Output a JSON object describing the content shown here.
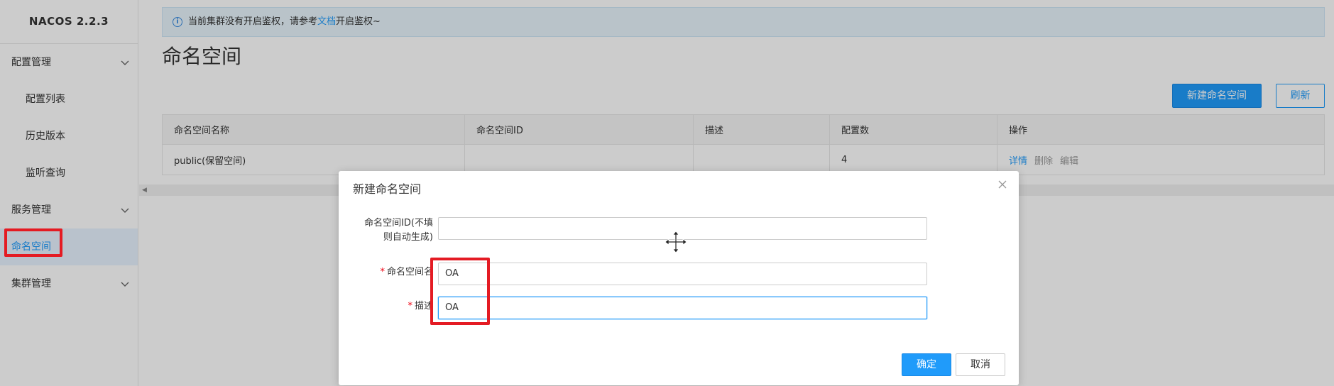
{
  "app": {
    "brand": "NACOS 2.2.3"
  },
  "sidebar": {
    "groups": [
      {
        "label": "配置管理",
        "items": [
          "配置列表",
          "历史版本",
          "监听查询"
        ]
      },
      {
        "label": "服务管理",
        "items": []
      },
      {
        "active_item": "命名空间"
      },
      {
        "label": "集群管理",
        "items": []
      }
    ]
  },
  "notice": {
    "prefix": "当前集群没有开启鉴权，请参考",
    "link": "文档",
    "suffix": "开启鉴权~"
  },
  "page": {
    "title": "命名空间"
  },
  "toolbar": {
    "create_label": "新建命名空间",
    "refresh_label": "刷新"
  },
  "table": {
    "columns": [
      "命名空间名称",
      "命名空间ID",
      "描述",
      "配置数",
      "操作"
    ],
    "rows": [
      {
        "name": "public(保留空间)",
        "id": "",
        "desc": "",
        "count": "4",
        "ops": [
          "详情",
          "删除",
          "编辑"
        ]
      }
    ]
  },
  "dialog": {
    "title": "新建命名空间",
    "fields": [
      {
        "label_line1": "命名空间ID(不填",
        "label_line2": "则自动生成)",
        "value": "",
        "required": false
      },
      {
        "label": "命名空间名",
        "value": "OA",
        "required": true
      },
      {
        "label": "描述",
        "value": "OA",
        "required": true,
        "focused": true
      }
    ],
    "confirm_label": "确定",
    "cancel_label": "取消"
  },
  "colors": {
    "primary": "#209bfa",
    "highlight": "#e41b23",
    "overlay": "rgba(0,0,0,0.2)"
  },
  "icons": [
    "chevron-down-icon",
    "info-icon",
    "close-icon",
    "move-cursor-icon"
  ]
}
